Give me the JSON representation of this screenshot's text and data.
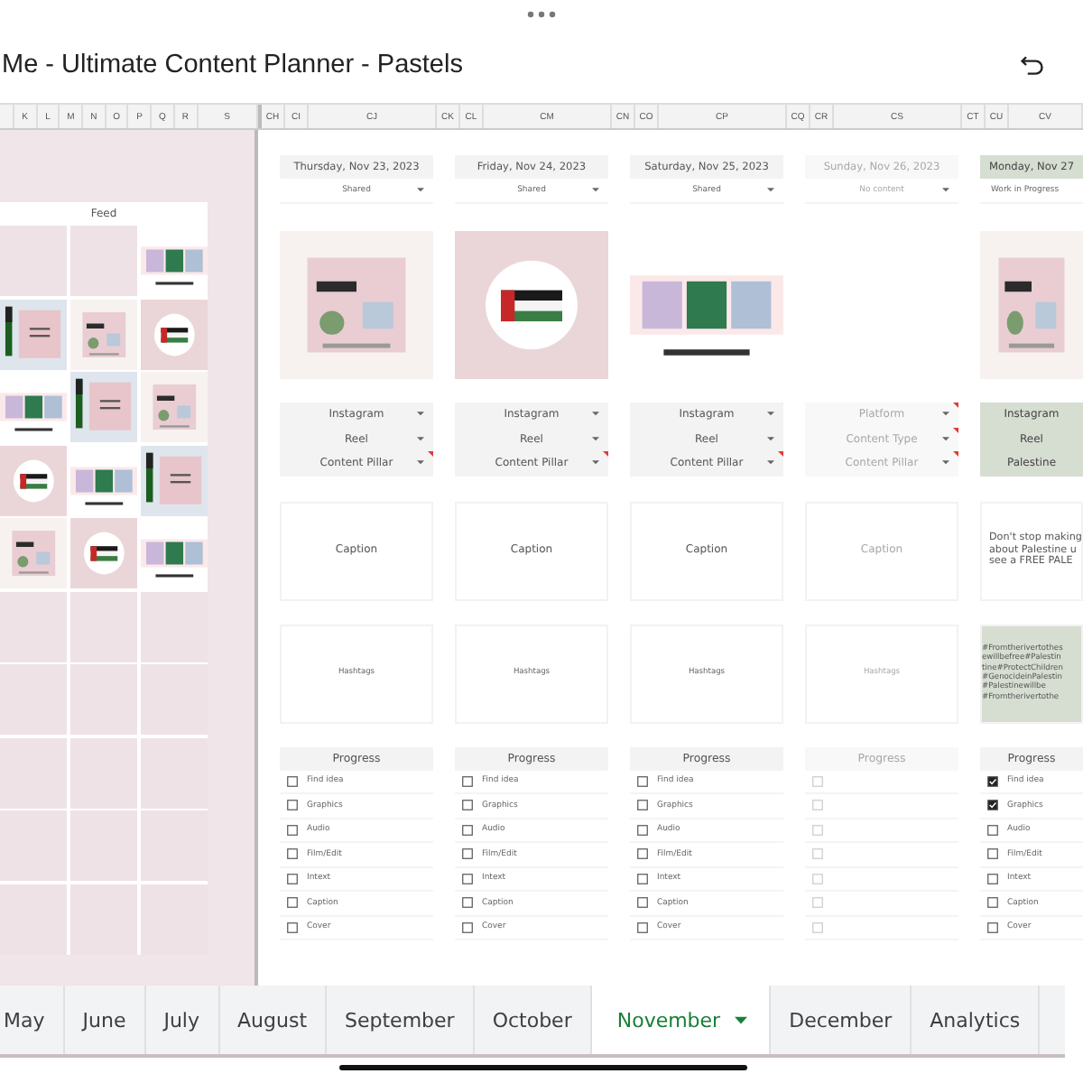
{
  "title": "Me - Ultimate Content Planner - Pastels",
  "column_headers_left": [
    {
      "kind": "narrow"
    },
    {
      "label": "K",
      "kind": "narrow"
    },
    {
      "label": "L",
      "kind": "narrow"
    },
    {
      "label": "M",
      "kind": "narrow"
    },
    {
      "label": "N",
      "kind": "narrow"
    },
    {
      "label": "O",
      "kind": "narrow"
    },
    {
      "label": "P",
      "kind": "narrow"
    },
    {
      "label": "Q",
      "kind": "narrow"
    },
    {
      "label": "R",
      "kind": "narrow"
    },
    {
      "label": "S",
      "kind": "wide"
    }
  ],
  "column_headers_right": [
    {
      "label": "CH",
      "kind": "narrow"
    },
    {
      "label": "CI",
      "kind": "narrow"
    },
    {
      "label": "CJ",
      "kind": "wide"
    },
    {
      "label": "CK",
      "kind": "narrow"
    },
    {
      "label": "CL",
      "kind": "narrow"
    },
    {
      "label": "CM",
      "kind": "wide"
    },
    {
      "label": "CN",
      "kind": "narrow"
    },
    {
      "label": "CO",
      "kind": "narrow"
    },
    {
      "label": "CP",
      "kind": "wide"
    },
    {
      "label": "CQ",
      "kind": "narrow"
    },
    {
      "label": "CR",
      "kind": "narrow"
    },
    {
      "label": "CS",
      "kind": "wide"
    },
    {
      "label": "CT",
      "kind": "narrow"
    },
    {
      "label": "CU",
      "kind": "narrow"
    },
    {
      "label": "CV",
      "kind": "rest"
    }
  ],
  "feed": {
    "title": "Feed",
    "cells": [
      {
        "kind": "empty"
      },
      {
        "kind": "empty"
      },
      {
        "kind": "picture"
      },
      {
        "kind": "picture"
      },
      {
        "kind": "picture"
      },
      {
        "kind": "picture"
      },
      {
        "kind": "picture"
      },
      {
        "kind": "picture"
      },
      {
        "kind": "picture"
      },
      {
        "kind": "picture"
      },
      {
        "kind": "picture"
      },
      {
        "kind": "picture"
      },
      {
        "kind": "picture"
      },
      {
        "kind": "picture"
      },
      {
        "kind": "picture"
      }
    ]
  },
  "days": [
    {
      "date": "Thursday, Nov 23, 2023",
      "status": "Shared",
      "faded": false,
      "highlighted": false,
      "image": {
        "kind": "picture"
      },
      "fields": [
        {
          "value": "Instagram",
          "note": false
        },
        {
          "value": "Reel",
          "note": false
        },
        {
          "value": "Content Pillar",
          "note": true
        }
      ],
      "caption": [
        "Caption"
      ],
      "hashtags": [
        "Hashtags"
      ],
      "progress": "Progress",
      "tasks": [
        {
          "label": "Find idea",
          "checked": false
        },
        {
          "label": "Graphics",
          "checked": false
        },
        {
          "label": "Audio",
          "checked": false
        },
        {
          "label": "Film/Edit",
          "checked": false
        },
        {
          "label": "Intext",
          "checked": false
        },
        {
          "label": "Caption",
          "checked": false
        },
        {
          "label": "Cover",
          "checked": false
        }
      ]
    },
    {
      "date": "Friday, Nov 24, 2023",
      "status": "Shared",
      "faded": false,
      "highlighted": false,
      "image": {
        "kind": "picture"
      },
      "fields": [
        {
          "value": "Instagram",
          "note": false
        },
        {
          "value": "Reel",
          "note": false
        },
        {
          "value": "Content Pillar",
          "note": true
        }
      ],
      "caption": [
        "Caption"
      ],
      "hashtags": [
        "Hashtags"
      ],
      "progress": "Progress",
      "tasks": [
        {
          "label": "Find idea",
          "checked": false
        },
        {
          "label": "Graphics",
          "checked": false
        },
        {
          "label": "Audio",
          "checked": false
        },
        {
          "label": "Film/Edit",
          "checked": false
        },
        {
          "label": "Intext",
          "checked": false
        },
        {
          "label": "Caption",
          "checked": false
        },
        {
          "label": "Cover",
          "checked": false
        }
      ]
    },
    {
      "date": "Saturday, Nov 25, 2023",
      "status": "Shared",
      "faded": false,
      "highlighted": false,
      "image": {
        "kind": "picture"
      },
      "fields": [
        {
          "value": "Instagram",
          "note": false
        },
        {
          "value": "Reel",
          "note": false
        },
        {
          "value": "Content Pillar",
          "note": true
        }
      ],
      "caption": [
        "Caption"
      ],
      "hashtags": [
        "Hashtags"
      ],
      "progress": "Progress",
      "tasks": [
        {
          "label": "Find idea",
          "checked": false
        },
        {
          "label": "Graphics",
          "checked": false
        },
        {
          "label": "Audio",
          "checked": false
        },
        {
          "label": "Film/Edit",
          "checked": false
        },
        {
          "label": "Intext",
          "checked": false
        },
        {
          "label": "Caption",
          "checked": false
        },
        {
          "label": "Cover",
          "checked": false
        }
      ]
    },
    {
      "date": "Sunday, Nov 26, 2023",
      "status": "No content",
      "faded": true,
      "highlighted": false,
      "image": {
        "kind": "empty"
      },
      "fields": [
        {
          "placeholder": "Platform",
          "note": true
        },
        {
          "placeholder": "Content Type",
          "note": true
        },
        {
          "placeholder": "Content Pillar",
          "note": true
        }
      ],
      "caption": [
        "Caption"
      ],
      "hashtags": [
        "Hashtags"
      ],
      "progress": "Progress",
      "tasks": [
        {
          "checked": false
        },
        {
          "checked": false
        },
        {
          "checked": false
        },
        {
          "checked": false
        },
        {
          "checked": false
        },
        {
          "checked": false
        },
        {
          "checked": false
        }
      ]
    },
    {
      "date": "Monday, Nov 27",
      "status": "Work in Progress",
      "faded": false,
      "highlighted": true,
      "image": {
        "kind": "picture"
      },
      "fields": [
        {
          "value": "Instagram",
          "note": false
        },
        {
          "value": "Reel",
          "note": false
        },
        {
          "value": "Palestine",
          "note": false
        }
      ],
      "caption": [
        "Don't stop making",
        "about Palestine u",
        "see a FREE PALE"
      ],
      "hashtags": [
        "#Fromtherivertothes",
        "ewillbefree#Palestin",
        "tine#ProtectChildren",
        "#GenocideinPalestin",
        "#Palestinewillbe",
        "#Fromtherivertothe"
      ],
      "progress": "Progress",
      "tasks": [
        {
          "label": "Find idea",
          "checked": true
        },
        {
          "label": "Graphics",
          "checked": true
        },
        {
          "label": "Audio",
          "checked": false
        },
        {
          "label": "Film/Edit",
          "checked": false
        },
        {
          "label": "Intext",
          "checked": false
        },
        {
          "label": "Caption",
          "checked": false
        },
        {
          "label": "Cover",
          "checked": false
        }
      ]
    }
  ],
  "tabs": [
    {
      "label": "May",
      "selected": false
    },
    {
      "label": "June",
      "selected": false
    },
    {
      "label": "July",
      "selected": false
    },
    {
      "label": "August",
      "selected": false
    },
    {
      "label": "September",
      "selected": false
    },
    {
      "label": "October",
      "selected": false
    },
    {
      "label": "November",
      "selected": true
    },
    {
      "label": "December",
      "selected": false
    },
    {
      "label": "Analytics",
      "selected": false
    }
  ]
}
